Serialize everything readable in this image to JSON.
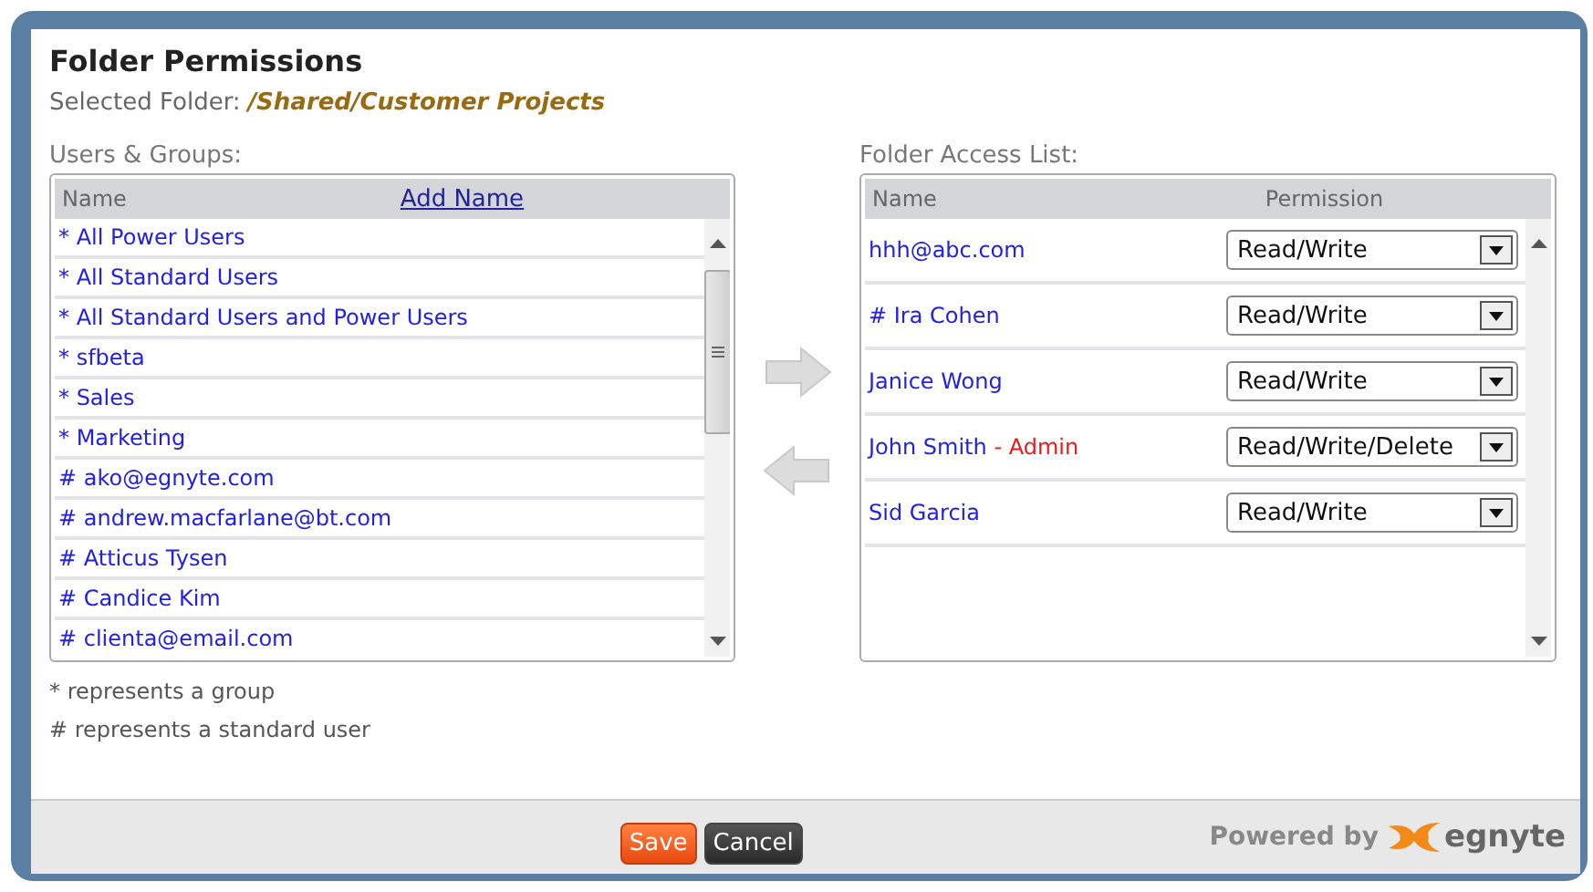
{
  "dialog": {
    "title": "Folder Permissions",
    "selected_folder_label": "Selected Folder:",
    "selected_folder": "/Shared/Customer Projects"
  },
  "users_groups": {
    "label": "Users & Groups:",
    "column": "Name",
    "add_link": "Add Name",
    "items": [
      {
        "name": "* All Power Users"
      },
      {
        "name": "* All Standard Users"
      },
      {
        "name": "* All Standard Users and Power Users"
      },
      {
        "name": "* sfbeta"
      },
      {
        "name": "* Sales"
      },
      {
        "name": "* Marketing"
      },
      {
        "name": "# ako@egnyte.com"
      },
      {
        "name": "# andrew.macfarlane@bt.com"
      },
      {
        "name": "# Atticus Tysen"
      },
      {
        "name": "# Candice Kim"
      },
      {
        "name": "# clienta@email.com"
      }
    ]
  },
  "access_list": {
    "label": "Folder Access List:",
    "columns": [
      "Name",
      "Permission"
    ],
    "rows": [
      {
        "name": "hhh@abc.com",
        "permission": "Read/Write"
      },
      {
        "name": "# Ira Cohen",
        "permission": "Read/Write"
      },
      {
        "name": "Janice Wong",
        "permission": "Read/Write"
      },
      {
        "name": "John Smith",
        "role": "- Admin",
        "permission": "Read/Write/Delete"
      },
      {
        "name": "Sid Garcia",
        "permission": "Read/Write"
      }
    ]
  },
  "legend": [
    "* represents a group",
    "# represents a standard user"
  ],
  "footer": {
    "buttons": [
      {
        "label": "Save",
        "kind": "primary"
      },
      {
        "label": "Cancel",
        "kind": "secondary"
      }
    ],
    "powered_by": "Powered by",
    "logo": "egnyte"
  }
}
